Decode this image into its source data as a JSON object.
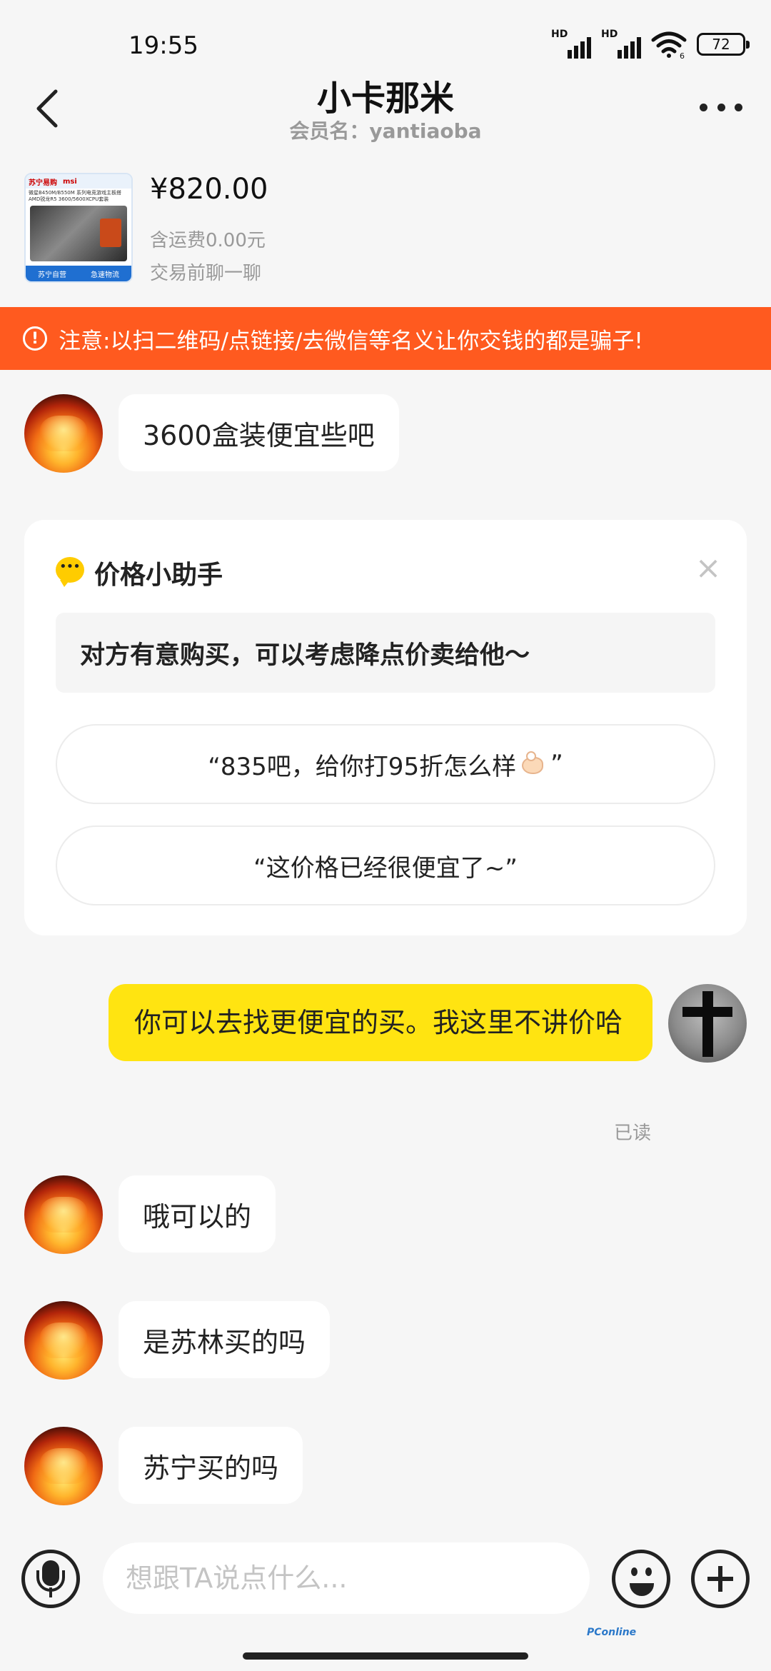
{
  "status_bar": {
    "time": "19:55",
    "battery": "72",
    "signal_label": "HD",
    "wifi_label": "6"
  },
  "header": {
    "title": "小卡那米",
    "subtitle": "会员名：yantiaoba"
  },
  "product": {
    "price": "¥820.00",
    "shipping": "含运费0.00元",
    "hint": "交易前聊一聊",
    "thumb_brand_1": "苏宁易购",
    "thumb_brand_2": "msi",
    "thumb_desc": "微星B450M/B550M 系列电竞游戏主板搭AMD锐龙R5 3600/5600XCPU套装",
    "thumb_tag_1": "苏宁自营",
    "thumb_tag_2": "急速物流"
  },
  "warning": {
    "text": "注意:以扫二维码/点链接/去微信等名义让你交钱的都是骗子!"
  },
  "messages": {
    "m1": "3600盒装便宜些吧",
    "m2": "你可以去找更便宜的买。我这里不讲价哈",
    "m2_status": "已读",
    "m3": "哦可以的",
    "m4": "是苏林买的吗",
    "m5": "苏宁买的吗"
  },
  "assistant": {
    "title": "价格小助手",
    "close": "×",
    "tip": "对方有意购买，可以考虑降点价卖给他～",
    "option_1_pre": "“835吧，给你打95折怎么样",
    "option_1_post": "”",
    "option_2": "“这价格已经很便宜了~”"
  },
  "input": {
    "placeholder": "想跟TA说点什么..."
  },
  "watermark": "PConline",
  "icons": [
    "back-icon",
    "more-icon",
    "warning-icon",
    "chat-bubble-icon",
    "close-icon",
    "ok-hand-icon",
    "microphone-icon",
    "emoji-icon",
    "plus-icon"
  ],
  "colors": {
    "warning_bg": "#ff5a1f",
    "self_bubble": "#ffe411",
    "background": "#f6f6f6"
  }
}
